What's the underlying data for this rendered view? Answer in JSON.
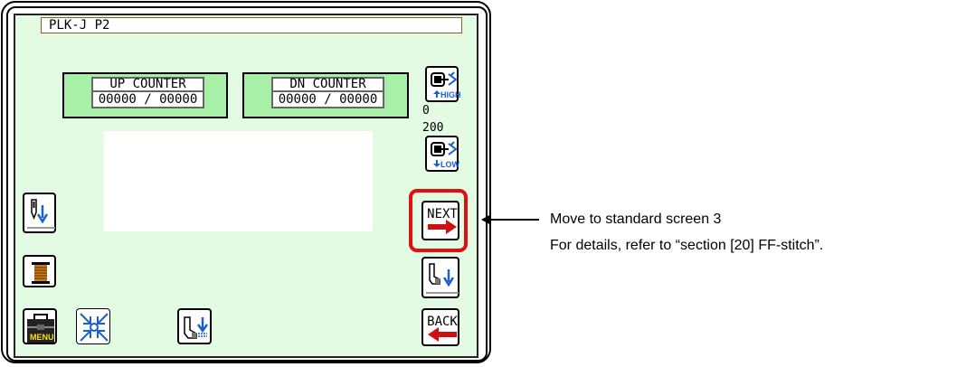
{
  "window": {
    "title": "PLK-J P2"
  },
  "counters": {
    "up_label": "UP COUNTER",
    "up_value": "00000 / 00000",
    "dn_label": "DN COUNTER",
    "dn_value": "00000 / 00000"
  },
  "speed": {
    "high_label": "HIGH",
    "current_value": "0",
    "max_value": "200",
    "low_label": "LOW"
  },
  "buttons": {
    "next_label": "NEXT",
    "back_label": "BACK",
    "menu_label": "MENU"
  },
  "annotation": {
    "line1": "Move to standard screen 3",
    "line2": "For details, refer to “section [20] FF-stitch”."
  },
  "colors": {
    "screen_bg": "#e3fbe3",
    "counter_bg": "#a8f0a8",
    "highlight": "#e01010",
    "arrow_red": "#d01010",
    "icon_blue": "#1a5fd0"
  },
  "icons": [
    "needle-down-icon",
    "bobbin-icon",
    "menu-icon",
    "shrink-icon",
    "presser-foot-icon",
    "speed-high-icon",
    "speed-low-icon",
    "next-arrow-icon",
    "presser-down-icon",
    "back-arrow-icon"
  ]
}
